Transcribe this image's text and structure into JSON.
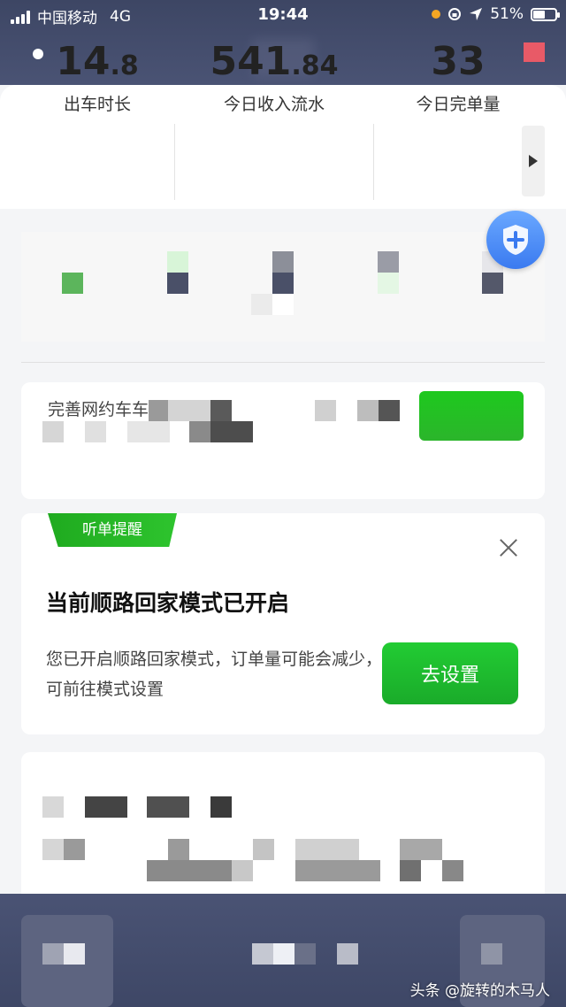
{
  "status_bar": {
    "carrier": "中国移动",
    "network": "4G",
    "time": "19:44",
    "battery": "51%"
  },
  "stats": [
    {
      "value_int": "14",
      "value_dec": ".8",
      "label": "出车时长"
    },
    {
      "value_int": "541",
      "value_dec": ".84",
      "label": "今日收入流水"
    },
    {
      "value_int": "33",
      "value_dec": "",
      "label": "今日完单量"
    }
  ],
  "card1": {
    "text": "完善网约车车"
  },
  "reminder": {
    "tag": "听单提醒",
    "title": "当前顺路回家模式已开启",
    "desc": "您已开启顺路回家模式，订单量可能会减少，可前往模式设置",
    "button": "去设置"
  },
  "watermark": "头条 @旋转的木马人",
  "colors": {
    "header": "#414a6a",
    "green": "#22c12e",
    "shield_blue": "#4a8cf7"
  }
}
